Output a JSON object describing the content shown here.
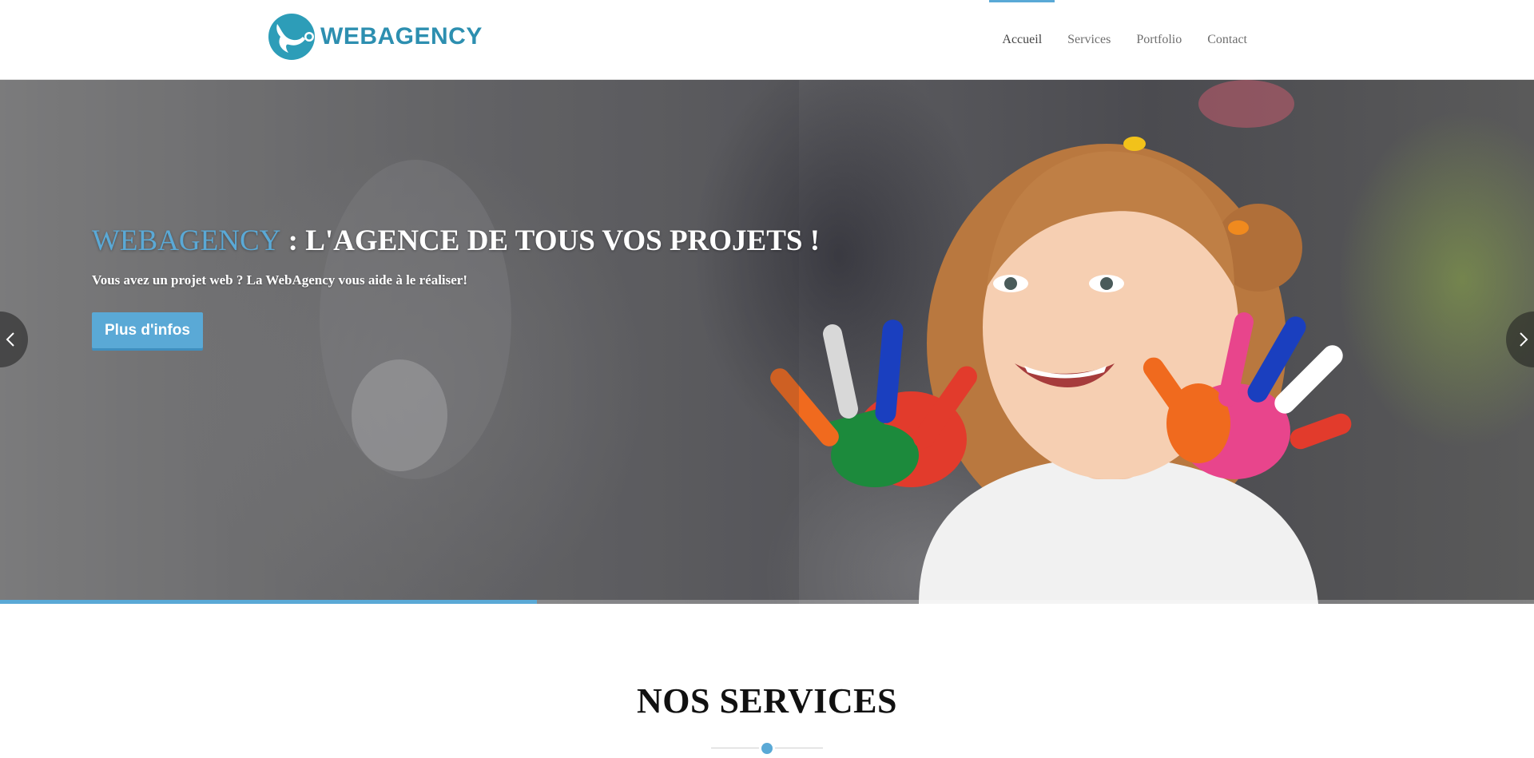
{
  "header": {
    "logo_text": "WEBAGENCY",
    "nav": [
      {
        "label": "Accueil",
        "active": true
      },
      {
        "label": "Services",
        "active": false
      },
      {
        "label": "Portfolio",
        "active": false
      },
      {
        "label": "Contact",
        "active": false
      }
    ]
  },
  "hero": {
    "title_brand": "WEBAGENCY",
    "title_rest": " : L'AGENCE DE TOUS VOS PROJETS !",
    "subtitle": "Vous avez un projet web ? La WebAgency vous aide à le réaliser!",
    "button_label": "Plus d'infos",
    "slide_progress": 0.35
  },
  "services": {
    "title": "NOS SERVICES"
  },
  "colors": {
    "accent": "#5aa9d6",
    "logo": "#2d8fb0"
  },
  "icons": {
    "prev": "chevron-left-icon",
    "next": "chevron-right-icon"
  }
}
